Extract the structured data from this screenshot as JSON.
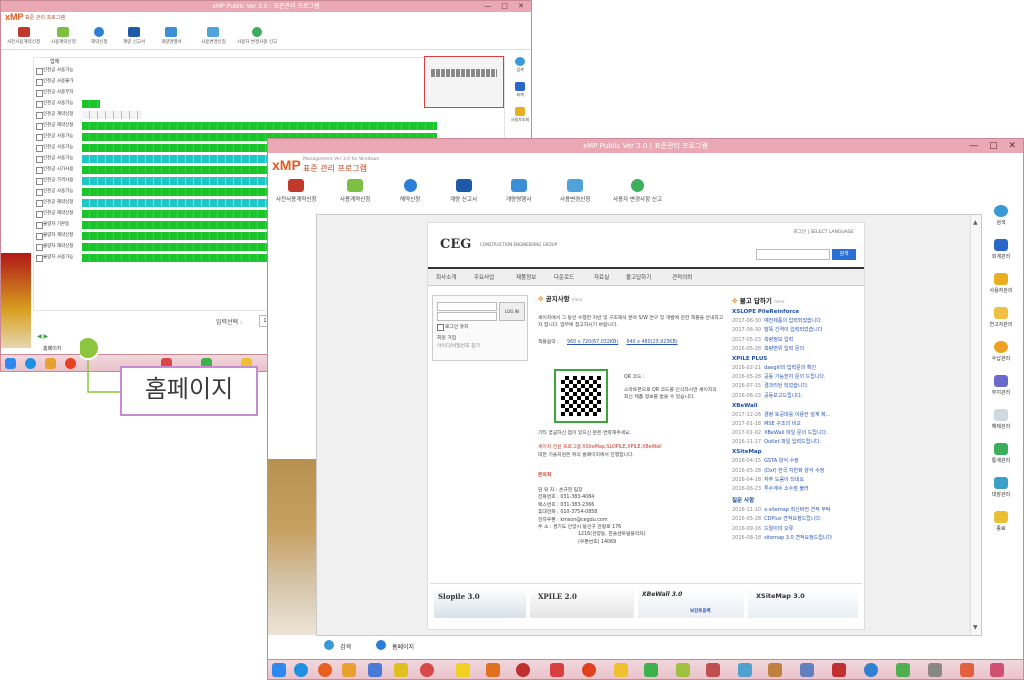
{
  "back_window": {
    "title": "xMP Public Ver 3.0 : 표준관리 프로그램",
    "logo": "xMP",
    "logo_sub": "표준 관리 프로그램",
    "toolbar": [
      "사전사용계약신청",
      "사용계약신청",
      "해약신청",
      "계량 신고서",
      "개량명행서",
      "사용변경신청",
      "사용자 변경사항 신고"
    ],
    "grid_header": "업체",
    "rows": [
      "인천공 사용가능",
      "인천공 사용불가",
      "인천공 사용부지",
      "인천공 사용가능",
      "인천공 계약신청",
      "인천공 해약신청",
      "인천공 사용가능",
      "인천공 사용가능",
      "인천공 사용가능",
      "인천공 시가사용",
      "인천공 가격사용",
      "인천공 사용가능",
      "인천공 해약신청",
      "인천공 해약신청",
      "불량자 기본등",
      "불량자 계약신청",
      "불량자 해약신청",
      "불량자 사용가능"
    ],
    "status_select": "입력선택 :",
    "status_value": "1",
    "sidebar": [
      "검색",
      "회계",
      "사용자조회"
    ],
    "bottom_tab": "홈페이지"
  },
  "callout": "홈페이지",
  "front_window": {
    "title": "xMP Public Ver 3.0 | 표준관리 프로그램",
    "logo": "xMP",
    "logo_sub": "표준 관리 프로그램",
    "logo_version": "Management Ver 3.0 for Windows",
    "toolbar": [
      "사전사용계약신청",
      "사용계약신청",
      "해약신청",
      "계량 신고서",
      "개량명행서",
      "사용변경신청",
      "사용자 변경사항 신고"
    ],
    "sidebar": [
      "검색",
      "회계관리",
      "사용자관리",
      "연고자관리",
      "수납관리",
      "부지관리",
      "해제관리",
      "통계관리",
      "대장관리",
      "종료"
    ],
    "bottom_tabs": [
      "검색",
      "홈페이지"
    ]
  },
  "website": {
    "logo": "CEG",
    "logo_sub": "CONSTRUCTION ENGINEERING GROUP",
    "header_links": "로그인 | SELECT LANGUAGE",
    "search_button": "검색",
    "nav": [
      "회사소개",
      "주요사업",
      "제품정보",
      "다운로드",
      "자료실",
      "불고답하기",
      "견적의뢰"
    ],
    "login": {
      "id_placeholder": "",
      "button": "LOG IN",
      "remember": "로그인 유지",
      "join": "회원 가입",
      "find": "아이디/비밀번호 찾기"
    },
    "notice": {
      "title": "공지사항",
      "more": "more",
      "body": "세이지에서 그 동안 수행한 지반 및 구조해석 분야 S/W 연구 및 개발에 관한 책들을 안내하고자 합니다. 업무에 참고하시기 바랍니다.",
      "book_label": "책들음악 :",
      "book_link1": "960 x 720(67,032KB)",
      "book_link2": "640 x 480(23,923KB)",
      "qr_title": "QR 코드 :",
      "qr_text": "스마트폰으로 QR 코드를 인식하시면 세이지의 최신 제품 정보를 받을 수 있습니다.",
      "interest": "기타 궁금하신 점이 있으신 분은 연락해주세요.",
      "products": "세이지 전원 프로그램 XSiteMap,SLOPILE,XPILE,XBeWall",
      "support": "대한 기술지원은 위의 홈페이지에서 진행합니다.",
      "contact_title": "문의처",
      "contact": [
        "담 당 자 : 손규현 팀장",
        "전화번호 : 031-383-4084",
        "팩스번호 : 031-383-2366",
        "휴대전화 : 010-3754-0858",
        "전자우편 : kmson@cegdu.com",
        "주    소 : 경기도 안양시 동안구 관평로 176",
        "1216(관양동, 한솔센트럴플라자)",
        "(우편번호) 14069"
      ]
    },
    "answers": {
      "title": "불고 답하기",
      "more": "more",
      "groups": [
        {
          "name": "XSLOPE PileReinforce",
          "items": [
            [
              "2017-06-30",
              "예전제품의 입력되었습니다."
            ],
            [
              "2017-06-30",
              "말뚝 간격이 입력되었습니다"
            ],
            [
              "2017-05-23",
              "측량정보 입력"
            ],
            [
              "2016-05-28",
              "측량변위 입력 문의"
            ]
          ]
        },
        {
          "name": "XPILE PLUS",
          "items": [
            [
              "2016-02-21",
              "daegill의 입력문의 확인"
            ],
            [
              "2016-05-28",
              "공동 가능한지 문의 드립니다."
            ],
            [
              "2016-07-15",
              "결과리턴 되었습니다."
            ],
            [
              "2016-06-23",
              "공동보고드립니다."
            ]
          ]
        },
        {
          "name": "XBeWall",
          "items": [
            [
              "2017-12-26",
              "경량 토공대를 이용한 설계 제..."
            ],
            [
              "2017-01-18",
              "MSE 구조의 비교"
            ],
            [
              "2017-01-02",
              "XBeWall 파일 문의 드립니다."
            ],
            [
              "2016-11-17",
              "Outlet 파일 입력드립니다."
            ]
          ]
        },
        {
          "name": "XSiteMap",
          "items": [
            [
              "2016-04-15",
              "GSTA 양식 수정"
            ],
            [
              "2016-05-28",
              "(Dxf) 한국 지반화 양식 수정"
            ],
            [
              "2016-04-18",
              "자주 도움이 되네요"
            ],
            [
              "2016-06-23",
              "투수계수 소수점 불러"
            ]
          ]
        },
        {
          "name": "질문 사항",
          "items": [
            [
              "2016-11-10",
              "x-sitemap 최신버전 견적 부탁"
            ],
            [
              "2016-05-28",
              "CDPlus 견적요청드립니다."
            ],
            [
              "2016-09-16",
              "드릴이미 오류"
            ],
            [
              "2016-08-18",
              "sitemap 3.0 견적요청드립니다"
            ]
          ]
        }
      ]
    },
    "banners": [
      "Slopile 3.0",
      "XPILE 2.0",
      "XBeWall 3.0",
      "XSiteMap 3.0"
    ],
    "banner_sub": "보강토옹벽"
  },
  "colors": {
    "accent": "#e05a1f",
    "titlebar": "#e9a8b3",
    "bar_green": "#1bc42b",
    "bar_cyan": "#1fc6c6",
    "callout_dot": "#8cc63f",
    "callout_border": "#c78ccf"
  }
}
